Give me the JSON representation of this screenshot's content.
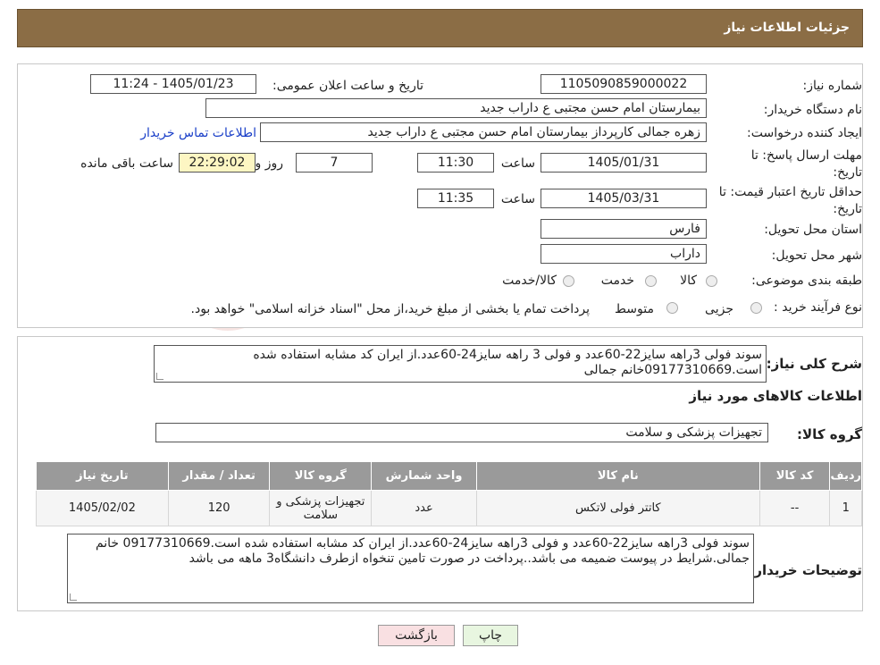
{
  "header": {
    "title": "جزئیات اطلاعات نیاز"
  },
  "watermark": {
    "text": "AriaTender.neT"
  },
  "form": {
    "need_number_label": "شماره نیاز:",
    "need_number": "1105090859000022",
    "announce_label": "تاریخ و ساعت اعلان عمومی:",
    "announce_value": "1405/01/23 - 11:24",
    "buyer_label": "نام دستگاه خریدار:",
    "buyer_value": "بیمارستان امام حسن مجتبی  ع  داراب جدید",
    "creator_label": "ایجاد کننده درخواست:",
    "creator_value": "زهره جمالی کارپرداز بیمارستان امام حسن مجتبی  ع  داراب جدید",
    "contact_link": "اطلاعات تماس خریدار",
    "deadline_label": "مهلت ارسال پاسخ: تا تاریخ:",
    "deadline_date": "1405/01/31",
    "time_label": "ساعت",
    "deadline_time": "11:30",
    "days_value": "7",
    "days_label": "روز و",
    "remaining_value": "22:29:02",
    "remaining_label": "ساعت باقی مانده",
    "validity_label": "حداقل تاریخ اعتبار قیمت: تا تاریخ:",
    "validity_date": "1405/03/31",
    "validity_time": "11:35",
    "province_label": "استان محل تحویل:",
    "province_value": "فارس",
    "city_label": "شهر محل تحویل:",
    "city_value": "داراب",
    "category_label": "طبقه بندی موضوعی:",
    "category_options": [
      "کالا",
      "خدمت",
      "کالا/خدمت"
    ],
    "process_label": "نوع فرآیند خرید :",
    "process_options": [
      "جزیی",
      "متوسط"
    ],
    "process_note": "پرداخت تمام یا بخشی از مبلغ خرید،از محل \"اسناد خزانه اسلامی\" خواهد بود."
  },
  "summary": {
    "label": "شرح کلی نیاز:",
    "text": "سوند فولی 3راهه سایز22-60عدد و فولی 3 راهه سایز24-60عدد.از ایران کد مشابه استفاده شده است.09177310669خانم جمالی",
    "items_title": "اطلاعات کالاهای مورد نیاز",
    "group_label": "گروه کالا:",
    "group_value": "تجهیزات پزشکی و سلامت"
  },
  "table": {
    "headers": [
      "ردیف",
      "کد کالا",
      "نام کالا",
      "واحد شمارش",
      "گروه کالا",
      "تعداد / مقدار",
      "تاریخ نیاز"
    ],
    "rows": [
      [
        "1",
        "--",
        "کاتتر فولی لاتکس",
        "عدد",
        "تجهیزات پزشکی و سلامت",
        "120",
        "1405/02/02"
      ]
    ]
  },
  "buyer_notes": {
    "label": "توضیحات خریدار:",
    "text": "سوند فولی 3راهه سایز22-60عدد و فولی  3راهه سایز24-60عدد.از ایران کد مشابه استفاده شده است.09177310669 خانم جمالی.شرایط در پیوست ضمیمه می باشد..پرداخت در صورت تامین تنخواه ازطرف دانشگاه3 ماهه می باشد"
  },
  "buttons": {
    "print": "چاپ",
    "back": "بازگشت"
  },
  "colors": {
    "header": "#8b6d45",
    "table_header": "#9a9a9a",
    "link": "#1a3fc8"
  }
}
